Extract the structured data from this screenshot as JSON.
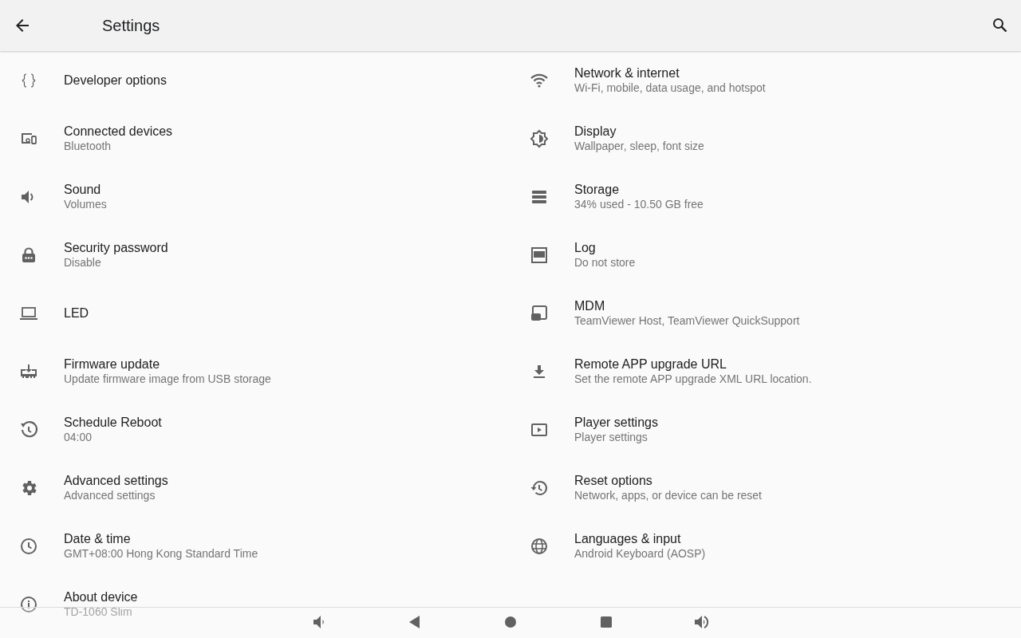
{
  "app_bar": {
    "title": "Settings"
  },
  "left_column": [
    {
      "title": "Developer options"
    },
    {
      "title": "Connected devices",
      "summary": "Bluetooth"
    },
    {
      "title": "Sound",
      "summary": "Volumes"
    },
    {
      "title": "Security password",
      "summary": "Disable"
    },
    {
      "title": "LED"
    },
    {
      "title": "Firmware update",
      "summary": "Update firmware image from USB storage"
    },
    {
      "title": "Schedule Reboot",
      "summary": "04:00"
    },
    {
      "title": "Advanced settings",
      "summary": "Advanced settings"
    },
    {
      "title": "Date & time",
      "summary": "GMT+08:00 Hong Kong Standard Time"
    },
    {
      "title": "About device",
      "summary": "TD-1060 Slim"
    }
  ],
  "right_column": [
    {
      "title": "Network & internet",
      "summary": "Wi-Fi, mobile, data usage, and hotspot"
    },
    {
      "title": "Display",
      "summary": "Wallpaper, sleep, font size"
    },
    {
      "title": "Storage",
      "summary": "34% used - 10.50 GB free"
    },
    {
      "title": "Log",
      "summary": "Do not store"
    },
    {
      "title": "MDM",
      "summary": "TeamViewer Host, TeamViewer QuickSupport"
    },
    {
      "title": "Remote APP upgrade URL",
      "summary": "Set the remote APP upgrade XML URL location."
    },
    {
      "title": "Player settings",
      "summary": "Player settings"
    },
    {
      "title": "Reset options",
      "summary": "Network, apps, or device can be reset"
    },
    {
      "title": "Languages & input",
      "summary": "Android Keyboard (AOSP)"
    }
  ]
}
